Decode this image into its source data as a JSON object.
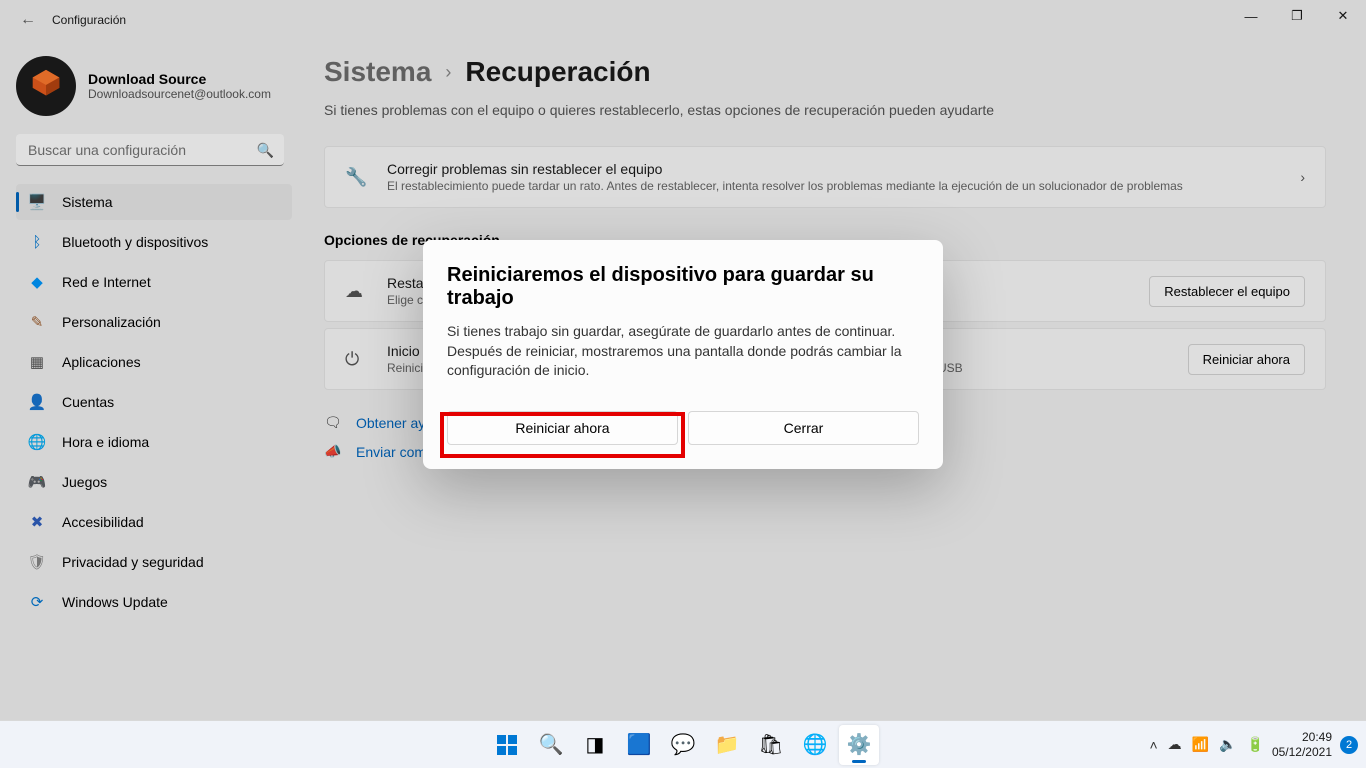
{
  "window": {
    "title": "Configuración"
  },
  "user": {
    "name": "Download Source",
    "email": "Downloadsourcenet@outlook.com"
  },
  "search": {
    "placeholder": "Buscar una configuración"
  },
  "nav": [
    {
      "label": "Sistema",
      "icon": "🖥️",
      "color": "#0078d4",
      "active": true
    },
    {
      "label": "Bluetooth y dispositivos",
      "icon": "ᛒ",
      "color": "#0078d4"
    },
    {
      "label": "Red e Internet",
      "icon": "◆",
      "color": "#0099ff"
    },
    {
      "label": "Personalización",
      "icon": "✎",
      "color": "#a06030"
    },
    {
      "label": "Aplicaciones",
      "icon": "▦",
      "color": "#555"
    },
    {
      "label": "Cuentas",
      "icon": "👤",
      "color": "#c0a020"
    },
    {
      "label": "Hora e idioma",
      "icon": "🌐",
      "color": "#5080c0"
    },
    {
      "label": "Juegos",
      "icon": "🎮",
      "color": "#777"
    },
    {
      "label": "Accesibilidad",
      "icon": "✖",
      "color": "#3060c0"
    },
    {
      "label": "Privacidad y seguridad",
      "icon": "🛡",
      "color": "#888"
    },
    {
      "label": "Windows Update",
      "icon": "⟳",
      "color": "#0078d4"
    }
  ],
  "breadcrumb": {
    "parent": "Sistema",
    "current": "Recuperación"
  },
  "subtitle": "Si tienes problemas con el equipo o quieres restablecerlo, estas opciones de recuperación pueden ayudarte",
  "card1": {
    "title": "Corregir problemas sin restablecer el equipo",
    "desc": "El restablecimiento puede tardar un rato. Antes de restablecer, intenta resolver los problemas mediante la ejecución de un solucionador de problemas"
  },
  "section": "Opciones de recuperación",
  "card2": {
    "title": "Restablecer este PC",
    "desc": "Elige conservar o quitar tus archivos personales y reinstalar Windows",
    "button": "Restablecer el equipo"
  },
  "card3": {
    "title": "Inicio avanzado",
    "desc": "Reinicia tu dispositivo para cambiar la configuración de inicio, incluido el inicio desde un disco o unidad USB",
    "button": "Reiniciar ahora"
  },
  "links": {
    "help": "Obtener ayuda",
    "feedback": "Enviar comentarios"
  },
  "dialog": {
    "title": "Reiniciaremos el dispositivo para guardar su trabajo",
    "body": "Si tienes trabajo sin guardar, asegúrate de guardarlo antes de continuar. Después de reiniciar, mostraremos una pantalla donde podrás cambiar la configuración de inicio.",
    "primary": "Reiniciar ahora",
    "secondary": "Cerrar"
  },
  "taskbar": {
    "time": "20:49",
    "date": "05/12/2021",
    "badge": "2"
  }
}
